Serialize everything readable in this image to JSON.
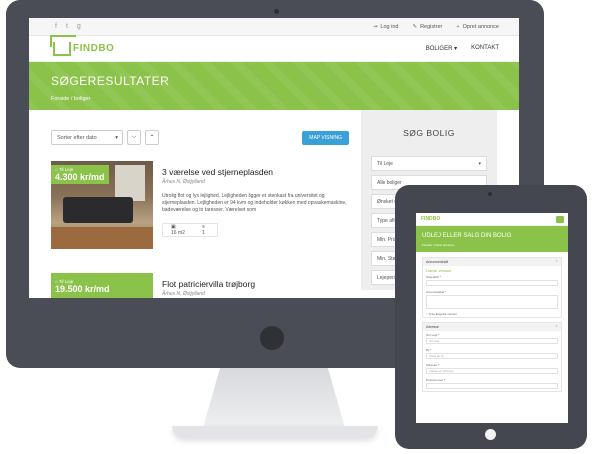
{
  "desktop": {
    "topbar": {
      "social": [
        "f",
        "t",
        "g"
      ],
      "links": [
        {
          "icon": "login-icon",
          "label": "Log ind"
        },
        {
          "icon": "edit-icon",
          "label": "Registrer"
        },
        {
          "icon": "plus-icon",
          "label": "Opret annonce"
        }
      ]
    },
    "header": {
      "logo": "FINDBO",
      "nav": [
        "BOLIGER",
        "KONTAKT"
      ]
    },
    "banner": {
      "title": "SØGERESULTATER",
      "breadcrumb": "Forside / boliger"
    },
    "controls": {
      "sort_label": "Sorter efter dato",
      "map_button": "MAP VISNING"
    },
    "listings": [
      {
        "tag_type": "Til Leje",
        "price": "4.300 kr/md",
        "title": "3 værelse ved stjerneplasden",
        "location": "Århus N, Østjylland",
        "description": "Utrolig flot og lys lejlighed. Lejligheden ligger et stenkast fra universitet og stjerneplasden. Lejligheden er 94 kvm og indeholder køkken med opvaskemaskine, badeværelse og to taresser. Værelset som",
        "area": "16 m2",
        "rooms": "1"
      },
      {
        "tag_type": "Til Leje",
        "price": "19.500 kr/md",
        "title": "Flot patriciervilla trøjborg",
        "location": "Århus N, Østjylland"
      }
    ],
    "sidebar": {
      "title": "SØG BOLIG",
      "fields": [
        "Til Leje",
        "Alle boliger",
        "Ønsket område",
        "Type afleje",
        "Min. Pris",
        "Min. Størrelse",
        "Lejeperiode"
      ]
    }
  },
  "tablet": {
    "logo": "FINDBO",
    "title": "UDLEJ ELLER SALG DIN BOLIG",
    "breadcrumb": "Forside / Opret annonce",
    "section1": "Annonsedetail",
    "green_label": "Dansk version",
    "label1": "Overskrift *",
    "label2": "Annoncetekst *",
    "checkbox": "Tyse Engelsk version",
    "section2": "Adresse",
    "label3": "Om Leje *",
    "value3": "Om leje",
    "label4": "By *",
    "value4": "Vælg en by",
    "label5": "Adresse *",
    "value5": "Indtast en adresse",
    "label6": "Postnummer *"
  },
  "colors": {
    "brand_green": "#8bc34a",
    "map_blue": "#3aa0d8",
    "bezel": "#4a4d56"
  }
}
